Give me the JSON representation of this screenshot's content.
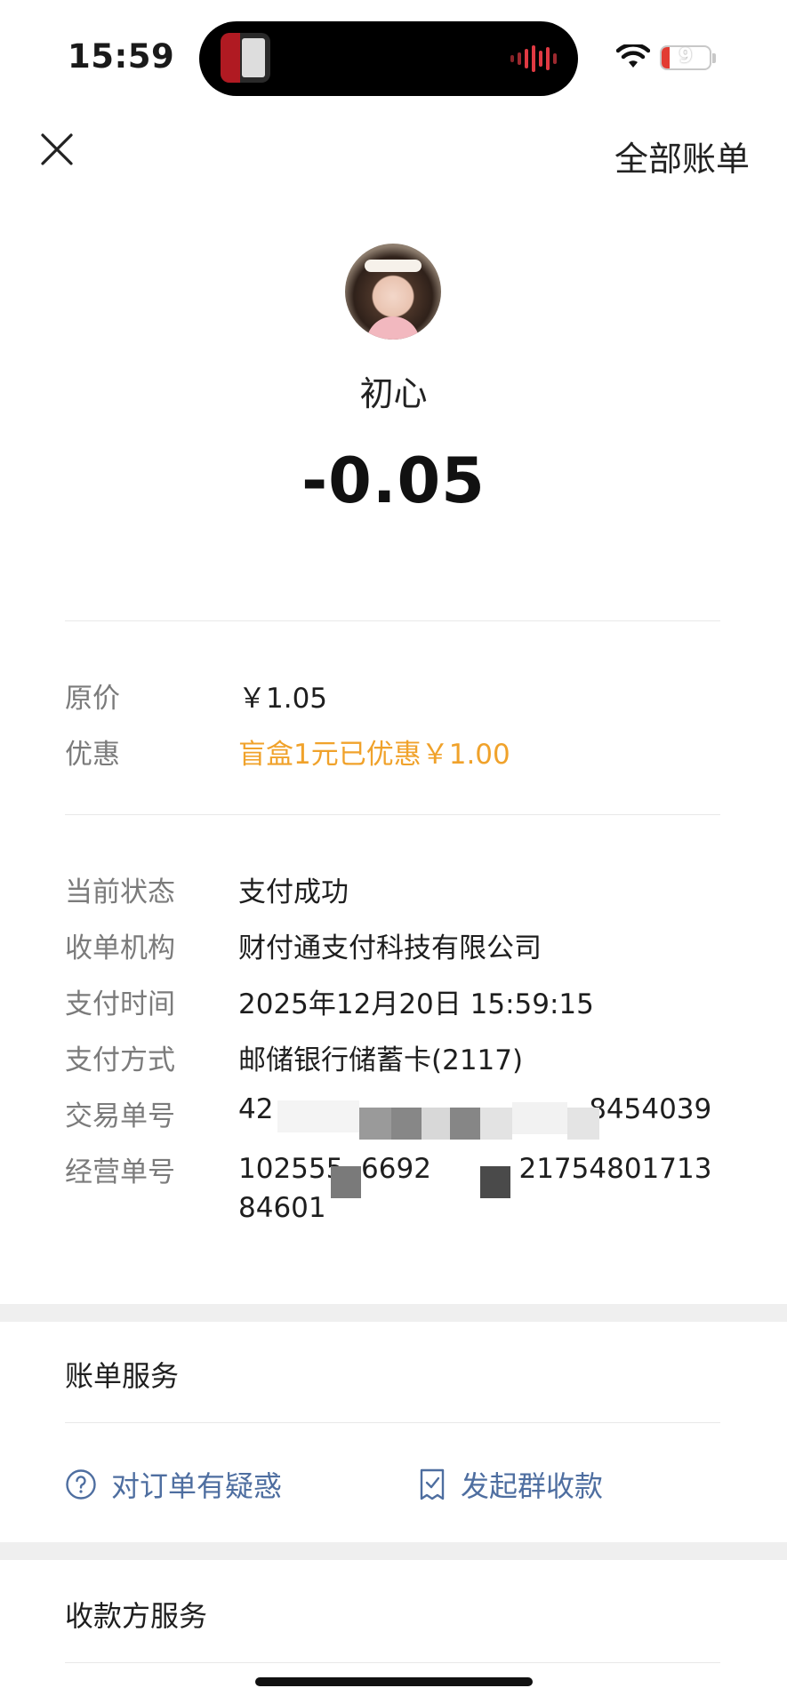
{
  "status_bar": {
    "time": "15:59",
    "battery_level": "9"
  },
  "header": {
    "all_bills_label": "全部账单"
  },
  "payee": {
    "name": "初心"
  },
  "amount": "-0.05",
  "price": {
    "original_label": "原价",
    "original_value": "￥1.05",
    "discount_label": "优惠",
    "discount_value": "盲盒1元已优惠￥1.00"
  },
  "details": [
    {
      "label": "当前状态",
      "value": "支付成功"
    },
    {
      "label": "收单机构",
      "value": "财付通支付科技有限公司"
    },
    {
      "label": "支付时间",
      "value": "2025年12月20日 15:59:15"
    },
    {
      "label": "支付方式",
      "value": "邮储银行储蓄卡(2117)"
    },
    {
      "label": "交易单号",
      "value": "42                                    8454039"
    },
    {
      "label": "经营单号",
      "value": "102555  6692          2175480171384601"
    }
  ],
  "bill_service": {
    "title": "账单服务",
    "actions": [
      {
        "label": "对订单有疑惑",
        "icon": "question-circle-icon"
      },
      {
        "label": "发起群收款",
        "icon": "receipt-icon"
      }
    ]
  },
  "payee_service": {
    "title": "收款方服务"
  },
  "colors": {
    "discount": "#f0a22b",
    "link": "#4e6ea0",
    "battery_low": "#e23b32"
  }
}
